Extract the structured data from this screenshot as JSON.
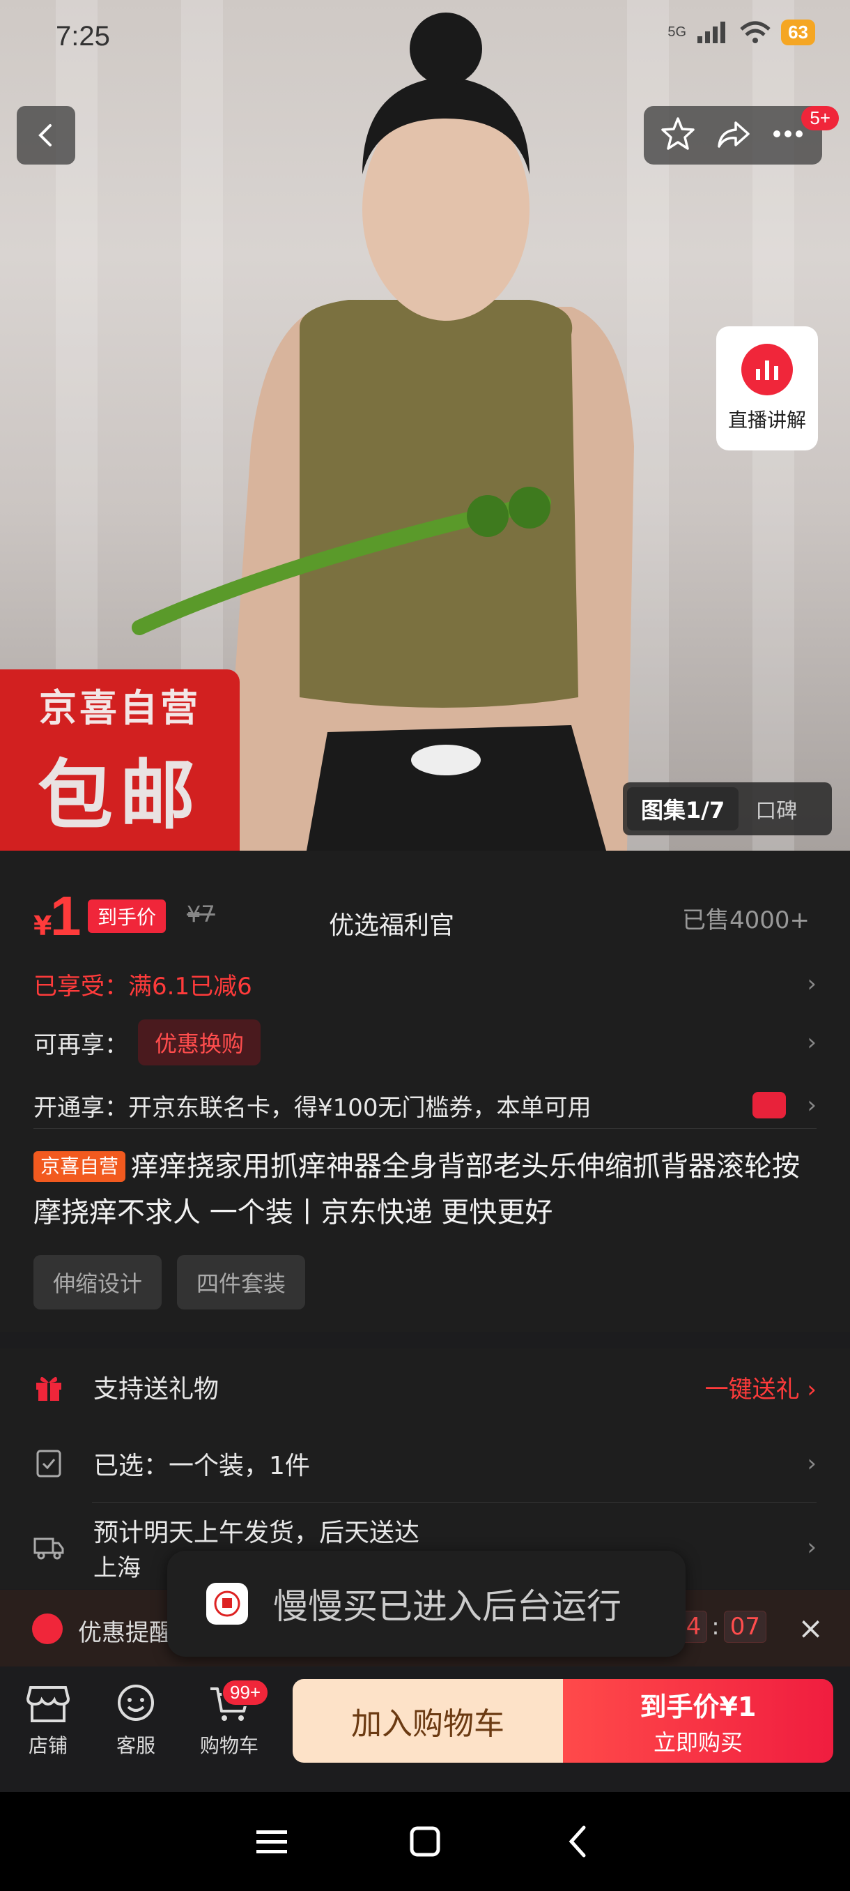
{
  "status": {
    "time": "7:25",
    "network": "5G",
    "battery": "63"
  },
  "hero": {
    "more_badge": "5+",
    "live_label": "直播讲解",
    "banner_line1": "京喜自营",
    "banner_line2": "包邮",
    "gallery_tab": "图集1/7",
    "reviews_tab": "口碑"
  },
  "price": {
    "currency": "¥",
    "value": "1",
    "tag": "到手价",
    "original": "¥7",
    "center_label": "优选福利官",
    "sold": "已售4000+"
  },
  "promos": {
    "enjoyed": "已享受：满6.1已减6",
    "more_label": "可再享：",
    "more_pill": "优惠换购",
    "open_label": "开通享：开京东联名卡，得¥100无门槛券，本单可用"
  },
  "product": {
    "badge": "京喜自营",
    "title": "痒痒挠家用抓痒神器全身背部老头乐伸缩抓背器滚轮按摩挠痒不求人 一个装丨京东快递 更快更好",
    "tags": [
      "伸缩设计",
      "四件套装"
    ]
  },
  "options": {
    "gift": "支持送礼物",
    "gift_action": "一键送礼",
    "gift_chevron": "›",
    "selected": "已选：一个装，1件",
    "shipping": "预计明天上午发货，后天送达",
    "shipping_sub": "上海",
    "chevron": "›"
  },
  "coupon_bar": {
    "text": "优惠提醒",
    "timer_min": "34",
    "timer_sec": "07",
    "colon": ":",
    "close": "×"
  },
  "toast": {
    "text": "慢慢买已进入后台运行"
  },
  "bottom": {
    "shop": "店铺",
    "service": "客服",
    "cart": "购物车",
    "cart_badge": "99+",
    "add_cart": "加入购物车",
    "buy_line1": "到手价¥1",
    "buy_line2": "立即购买"
  },
  "colors": {
    "accent": "#f0263a",
    "bg": "#1e1e1e"
  }
}
